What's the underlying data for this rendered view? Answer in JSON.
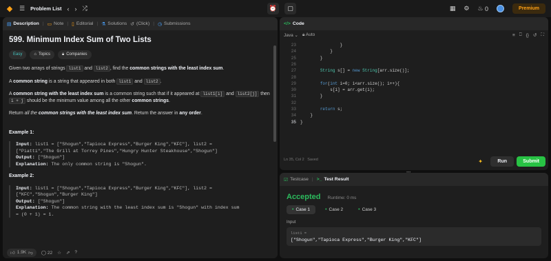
{
  "topbar": {
    "problem_list": "Problem List",
    "coins": "0",
    "premium": "Premium"
  },
  "left_tabs": [
    {
      "label": "Description",
      "icon": "doc-icon"
    },
    {
      "label": "Note",
      "icon": "note-icon"
    },
    {
      "label": "Editorial",
      "icon": "book-icon"
    },
    {
      "label": "Solutions",
      "icon": "flask-icon"
    },
    {
      "label": "(Click)",
      "icon": "history-icon"
    },
    {
      "label": "Submissions",
      "icon": "clock-icon"
    }
  ],
  "problem": {
    "title": "599. Minimum Index Sum of Two Lists",
    "difficulty": "Easy",
    "topics": "Topics",
    "companies": "Companies",
    "p1_a": "Given two arrays of strings ",
    "p1_c1": "list1",
    "p1_b": " and ",
    "p1_c2": "list2",
    "p1_c": ", find the ",
    "p1_bold": "common strings with the least index sum",
    "p1_d": ".",
    "p2_a": "A ",
    "p2_bold": "common string",
    "p2_b": " is a string that appeared in both ",
    "p2_c1": "list1",
    "p2_c": " and ",
    "p2_c2": "list2",
    "p2_d": ".",
    "p3_a": "A ",
    "p3_bold": "common string with the least index sum",
    "p3_b": " is a common string such that if it appeared at ",
    "p3_c1": "list1[i]",
    "p3_c": " and ",
    "p3_c2": "list2[j]",
    "p3_d": " then ",
    "p3_c3": "i + j",
    "p3_e": " should be the minimum value among all the other ",
    "p3_bold2": "common strings",
    "p3_f": ".",
    "p4_a": "Return ",
    "p4_ital": "all the ",
    "p4_bold": "common strings with the least index sum",
    "p4_b": ". Return the answer in ",
    "p4_bold2": "any order",
    "p4_c": ".",
    "ex1_title": "Example 1:",
    "ex1_input_label": "Input:",
    "ex1_input": " list1 = [\"Shogun\",\"Tapioca Express\",\"Burger King\",\"KFC\"], list2 =",
    "ex1_input2": "[\"Piatti\",\"The Grill at Torrey Pines\",\"Hungry Hunter Steakhouse\",\"Shogun\"]",
    "ex1_output_label": "Output:",
    "ex1_output": " [\"Shogun\"]",
    "ex1_expl_label": "Explanation:",
    "ex1_expl": " The only common string is \"Shogun\".",
    "ex2_title": "Example 2:",
    "ex2_input_label": "Input:",
    "ex2_input": " list1 = [\"Shogun\",\"Tapioca Express\",\"Burger King\",\"KFC\"], list2 =",
    "ex2_input2": "[\"KFC\",\"Shogun\",\"Burger King\"]",
    "ex2_output_label": "Output:",
    "ex2_output": " [\"Shogun\"]",
    "ex2_expl_label": "Explanation:",
    "ex2_expl": " The common string with the least index sum is \"Shogun\" with index sum",
    "ex2_expl2": "= (0 + 1) = 1."
  },
  "footer": {
    "likes": "1.9K",
    "comments": "22"
  },
  "code_panel": {
    "tab": "Code",
    "language": "Java",
    "mode": "Auto",
    "status_pos": "Ln 35, Col 2",
    "status_saved": "Saved",
    "run": "Run",
    "submit": "Submit",
    "lines": [
      {
        "n": "23",
        "code": "                }"
      },
      {
        "n": "24",
        "code": "            }"
      },
      {
        "n": "25",
        "code": "        }"
      },
      {
        "n": "26",
        "code": ""
      },
      {
        "n": "27",
        "code": "        String s[] = new String[arr.size()];"
      },
      {
        "n": "28",
        "code": ""
      },
      {
        "n": "29",
        "code": "        for(int i=0; i<arr.size(); i++){"
      },
      {
        "n": "30",
        "code": "            s[i] = arr.get(i);"
      },
      {
        "n": "31",
        "code": "        }"
      },
      {
        "n": "32",
        "code": ""
      },
      {
        "n": "33",
        "code": "        return s;"
      },
      {
        "n": "34",
        "code": "    }"
      },
      {
        "n": "35",
        "code": "}"
      }
    ]
  },
  "test_panel": {
    "tab_testcase": "Testcase",
    "tab_result": "Test Result",
    "verdict": "Accepted",
    "runtime": "Runtime: 0 ms",
    "cases": [
      "Case 1",
      "Case 2",
      "Case 3"
    ],
    "input_label": "Input",
    "input_key": "list1 =",
    "input_value": "[\"Shogun\",\"Tapioca Express\",\"Burger King\",\"KFC\"]"
  },
  "colors": {
    "accent": "#ffa116",
    "accepted": "#2cbb5d",
    "submit": "#28c244",
    "easy": "#46c6c2"
  }
}
